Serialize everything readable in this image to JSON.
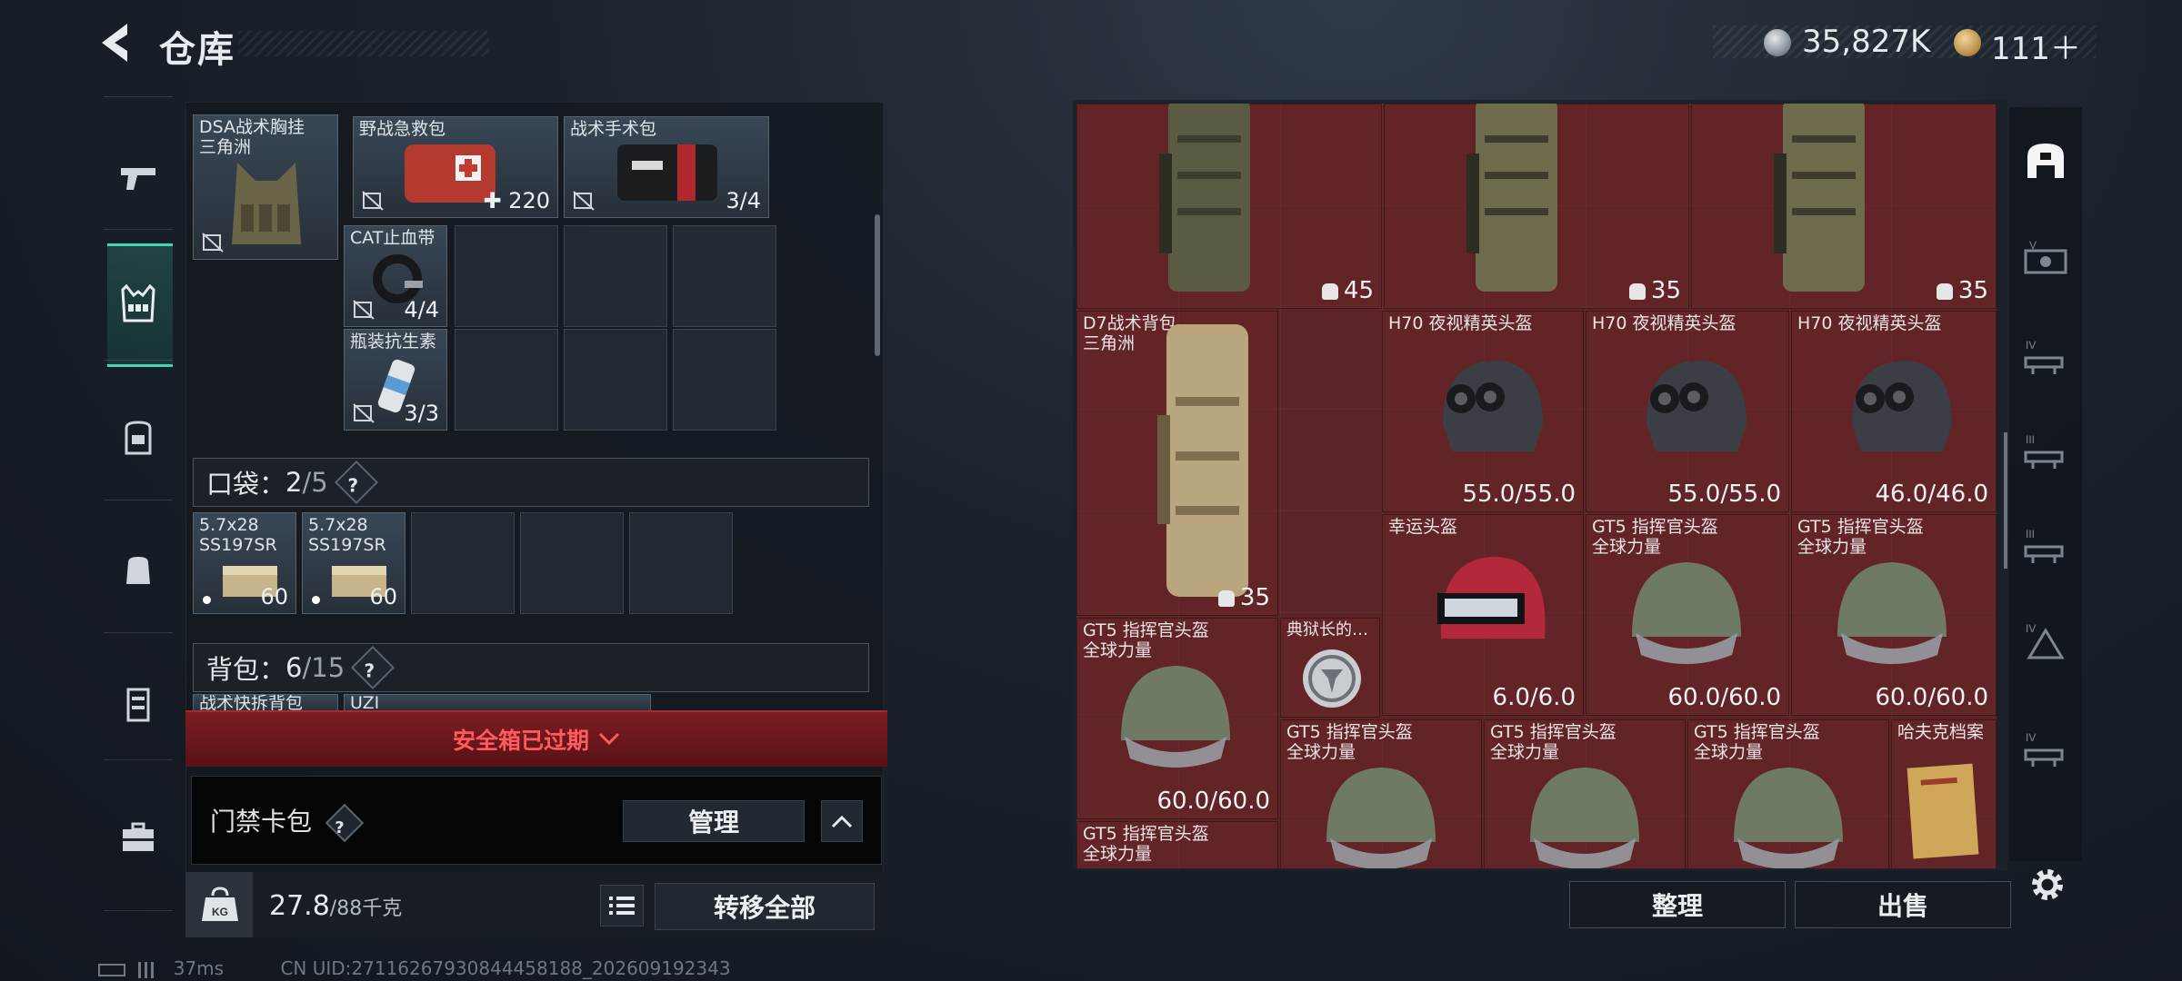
{
  "header": {
    "title": "仓库",
    "currency1": "35,827K",
    "currency2": "111＋"
  },
  "leftnav": {
    "items": [
      "weapons-icon",
      "vest-icon",
      "backpack-icon",
      "pouch-icon",
      "container-icon",
      "toolbox-icon"
    ]
  },
  "vest": {
    "items": [
      {
        "name": "DSA战术胸挂\n三角洲"
      },
      {
        "name": "野战急救包",
        "count": "220"
      },
      {
        "name": "战术手术包",
        "count": "3/4"
      },
      {
        "name": "CAT止血带",
        "count": "4/4"
      },
      {
        "name": "瓶装抗生素",
        "count": "3/3"
      }
    ]
  },
  "pockets": {
    "label": "口袋：",
    "count": "2",
    "cap": "/5",
    "q": "?",
    "items": [
      {
        "name": "5.7x28\nSS197SR",
        "count": "60"
      },
      {
        "name": "5.7x28\nSS197SR",
        "count": "60"
      }
    ]
  },
  "backpack": {
    "label": "背包：",
    "count": "6",
    "cap": "/15",
    "q": "?",
    "peek1": "战术快拆背包",
    "peek2": "UZI"
  },
  "safebox": {
    "text": "安全箱已过期"
  },
  "keycard": {
    "label": "门禁卡包",
    "q": "?",
    "manage": "管理"
  },
  "bottom": {
    "weight": "27.8",
    "capacity": "/88千克",
    "transfer": "转移全部"
  },
  "status": {
    "ping": "37ms",
    "uid": "CN UID:27116267930844458188_202609192343"
  },
  "stash": {
    "bags": [
      {
        "count": "45"
      },
      {
        "count": "35"
      },
      {
        "count": "35"
      }
    ],
    "cells": [
      {
        "name": "D7战术背包\n三角洲",
        "value": "35"
      },
      {
        "name": "H70 夜视精英头盔",
        "value": "55.0/55.0"
      },
      {
        "name": "H70 夜视精英头盔",
        "value": "55.0/55.0"
      },
      {
        "name": "H70 夜视精英头盔",
        "value": "46.0/46.0"
      },
      {
        "name": "幸运头盔",
        "value": "6.0/6.0"
      },
      {
        "name": "GT5 指挥官头盔\n全球力量",
        "value": "60.0/60.0"
      },
      {
        "name": "GT5 指挥官头盔\n全球力量",
        "value": "60.0/60.0"
      },
      {
        "name": "GT5 指挥官头盔\n全球力量",
        "value": "60.0/60.0"
      },
      {
        "name": "典狱长的…",
        "value": ""
      },
      {
        "name": "GT5 指挥官头盔\n全球力量",
        "value": ""
      },
      {
        "name": "GT5 指挥官头盔\n全球力量",
        "value": ""
      },
      {
        "name": "GT5 指挥官头盔\n全球力量",
        "value": ""
      },
      {
        "name": "哈夫克档案",
        "value": ""
      },
      {
        "name": "GT5 指挥官头盔\n全球力量",
        "value": ""
      }
    ],
    "sort": "整理",
    "sell": "出售"
  },
  "rightnav": {
    "tiers": [
      "",
      "V",
      "IV",
      "III",
      "III",
      "IV",
      "IV"
    ]
  },
  "colors": {
    "accent": "#3fd7b0",
    "stash_bg": "#5a2428",
    "warning": "#ff5a5e"
  }
}
